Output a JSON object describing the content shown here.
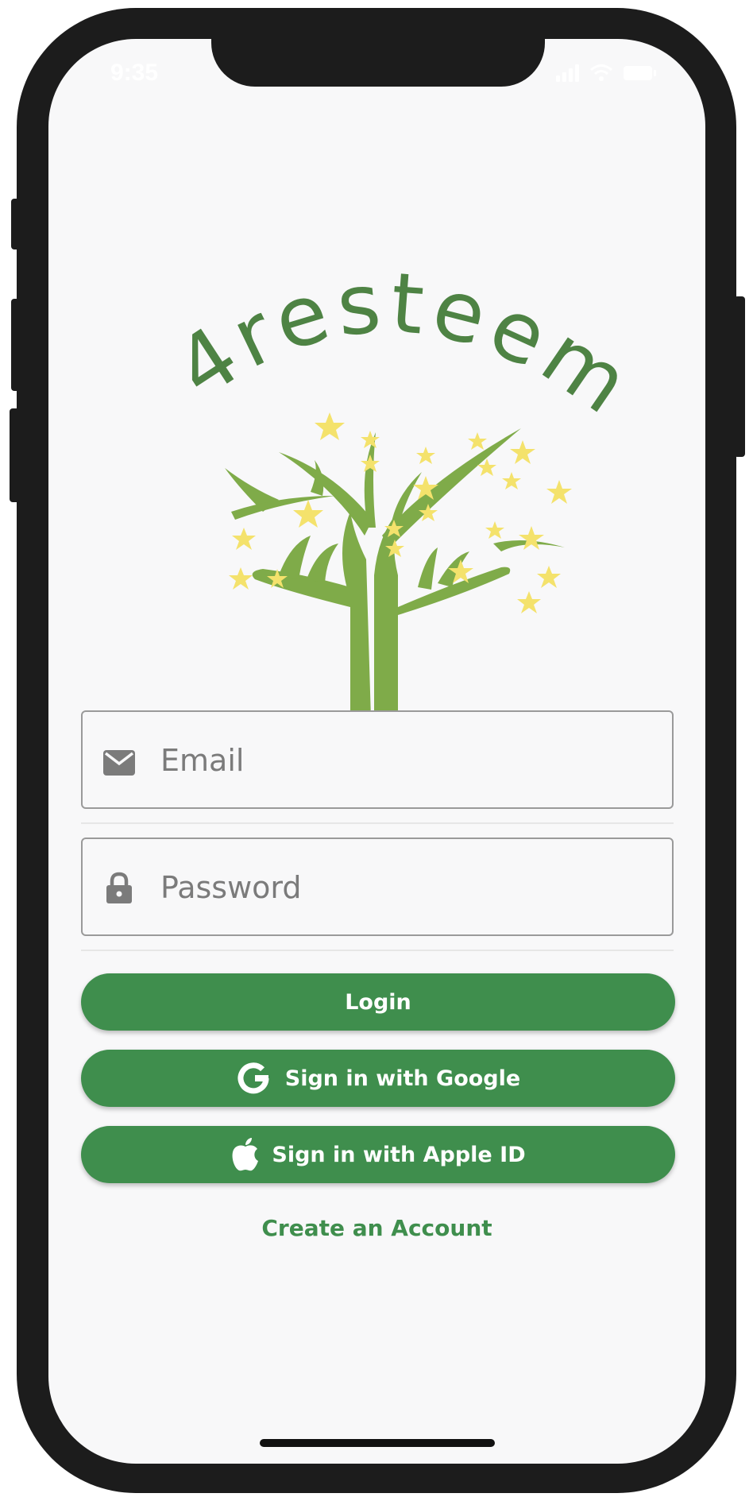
{
  "status_bar": {
    "time": "9:35"
  },
  "logo": {
    "brand_text": "4resteem"
  },
  "form": {
    "email_placeholder": "Email",
    "password_placeholder": "Password"
  },
  "buttons": {
    "login": "Login",
    "google": "Sign in with Google",
    "apple": "Sign in with Apple ID"
  },
  "links": {
    "create_account": "Create an Account"
  },
  "colors": {
    "primary_green": "#3f8e4d",
    "logo_green": "#7fab49",
    "logo_text": "#4e8344",
    "star_yellow": "#f4e26c",
    "background": "#f8f8f9"
  },
  "icons": {
    "email": "envelope-icon",
    "password": "lock-icon",
    "google": "google-icon",
    "apple": "apple-icon"
  }
}
